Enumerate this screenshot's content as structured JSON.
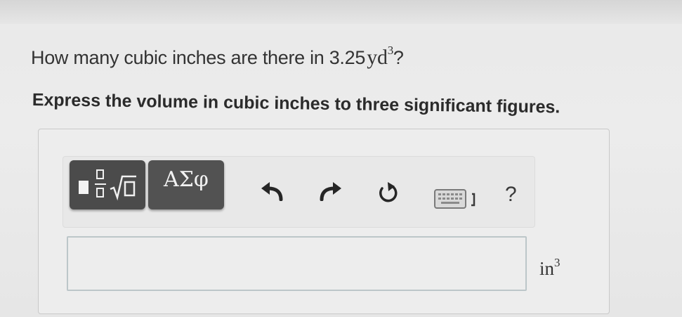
{
  "question": {
    "prefix": "How many cubic inches are there in",
    "value": "3.25",
    "unit": "yd",
    "exponent": "3",
    "suffix": "?"
  },
  "instruction": "Express the volume in cubic inches to three significant figures.",
  "toolbar": {
    "templates_icon": "fraction-sqrt-template-icon",
    "greek_label": "ΑΣφ",
    "undo_icon": "undo-arrow-icon",
    "redo_icon": "redo-arrow-icon",
    "reset_icon": "reset-circular-arrow-icon",
    "keyboard_icon": "keyboard-icon",
    "help_label": "?"
  },
  "answer": {
    "value": "",
    "unit": "in",
    "unit_exponent": "3"
  },
  "colors": {
    "background": "#ebebeb",
    "button_dark": "#4b4b4b",
    "input_border": "#bcc6c9"
  }
}
